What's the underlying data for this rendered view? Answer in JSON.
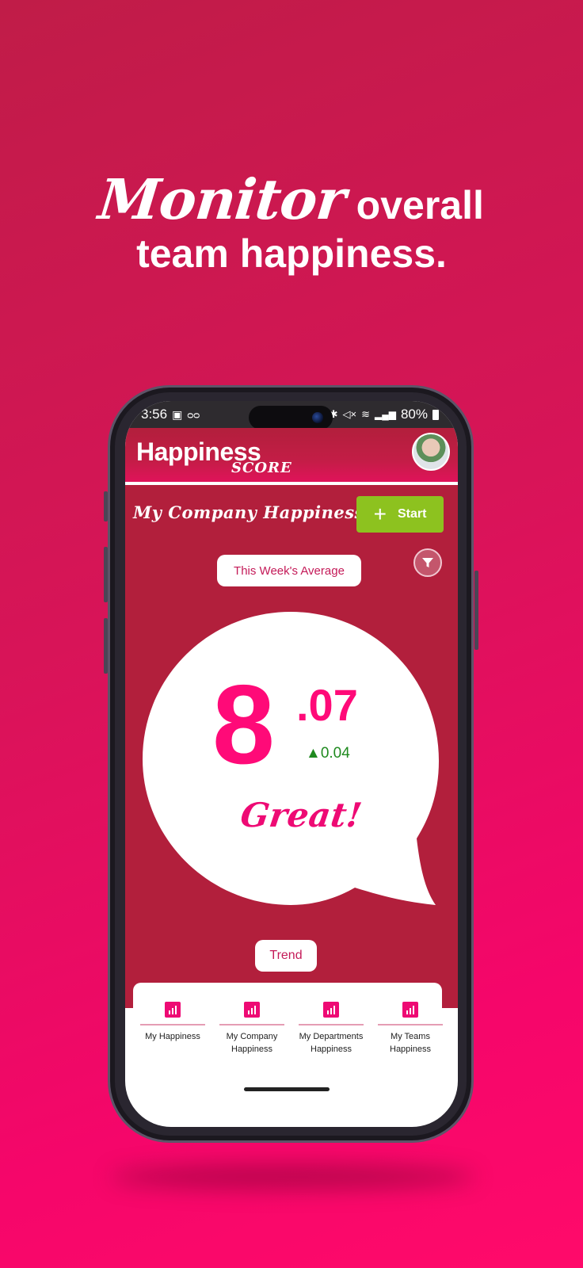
{
  "headline": {
    "script_word": "Monitor",
    "line1_rest": "overall",
    "line2": "team happiness."
  },
  "status_bar": {
    "time": "3:56",
    "battery": "80%"
  },
  "app": {
    "logo_main": "Happiness",
    "logo_sub": "SCORE"
  },
  "main": {
    "section_title": "My Company Happiness",
    "start_label": "Start",
    "period_label": "This Week's Average",
    "score_int": "8",
    "score_dec": ".07",
    "delta": "0.04",
    "mood": "Great!",
    "trend_label": "Trend"
  },
  "tabs": [
    {
      "label": "My Happiness"
    },
    {
      "label": "My Company Happiness"
    },
    {
      "label": "My Departments Happiness"
    },
    {
      "label": "My Teams Happiness"
    }
  ],
  "colors": {
    "accent": "#ff0a78",
    "primary_bg": "#b21f3c",
    "start_green": "#8dc21f",
    "delta_up": "#1f8a1f"
  }
}
